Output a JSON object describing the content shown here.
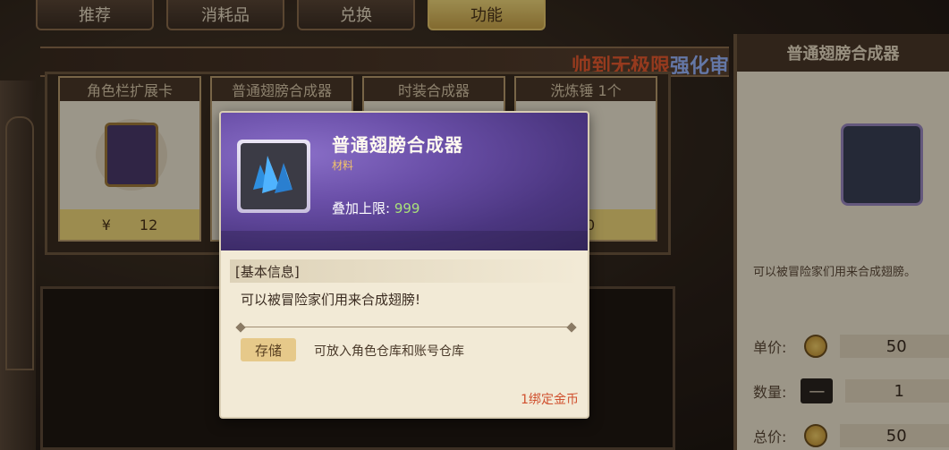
{
  "top_tabs": [
    {
      "label": "推荐"
    },
    {
      "label": "消耗品"
    },
    {
      "label": "兑换"
    },
    {
      "label": "功能"
    }
  ],
  "banner": {
    "part1": "帅到无极限",
    "part2": "强化审"
  },
  "shelf": {
    "cards": [
      {
        "title": "角色栏扩展卡",
        "currency": "¥",
        "price": "12"
      },
      {
        "title": "普通翅膀合成器",
        "currency": "",
        "price": ""
      },
      {
        "title": "时装合成器",
        "currency": "",
        "price": ""
      },
      {
        "title": "洗炼锤 1个",
        "currency": "",
        "price": "10"
      }
    ]
  },
  "detail_panel": {
    "title": "普通翅膀合成器",
    "description": "可以被冒险家们用来合成翅膀。",
    "unit_price_label": "单价:",
    "unit_price": "50",
    "quantity_label": "数量:",
    "quantity": "1",
    "total_label": "总价:",
    "total": "50",
    "minus_symbol": "—"
  },
  "tooltip": {
    "name": "普通翅膀合成器",
    "type": "材料",
    "stack_label": "叠加上限:",
    "stack_value": "999",
    "section_title": "[基本信息]",
    "description": "可以被冒险家们用来合成翅膀!",
    "tag": "存储",
    "tag_text": "可放入角色仓库和账号仓库",
    "bind_text": "1绑定金币"
  },
  "colors": {
    "accent_gold": "#f0d77a",
    "purple_header": "#6a4fa8",
    "stack_green": "#a9e07a",
    "bind_red": "#d0502e"
  }
}
